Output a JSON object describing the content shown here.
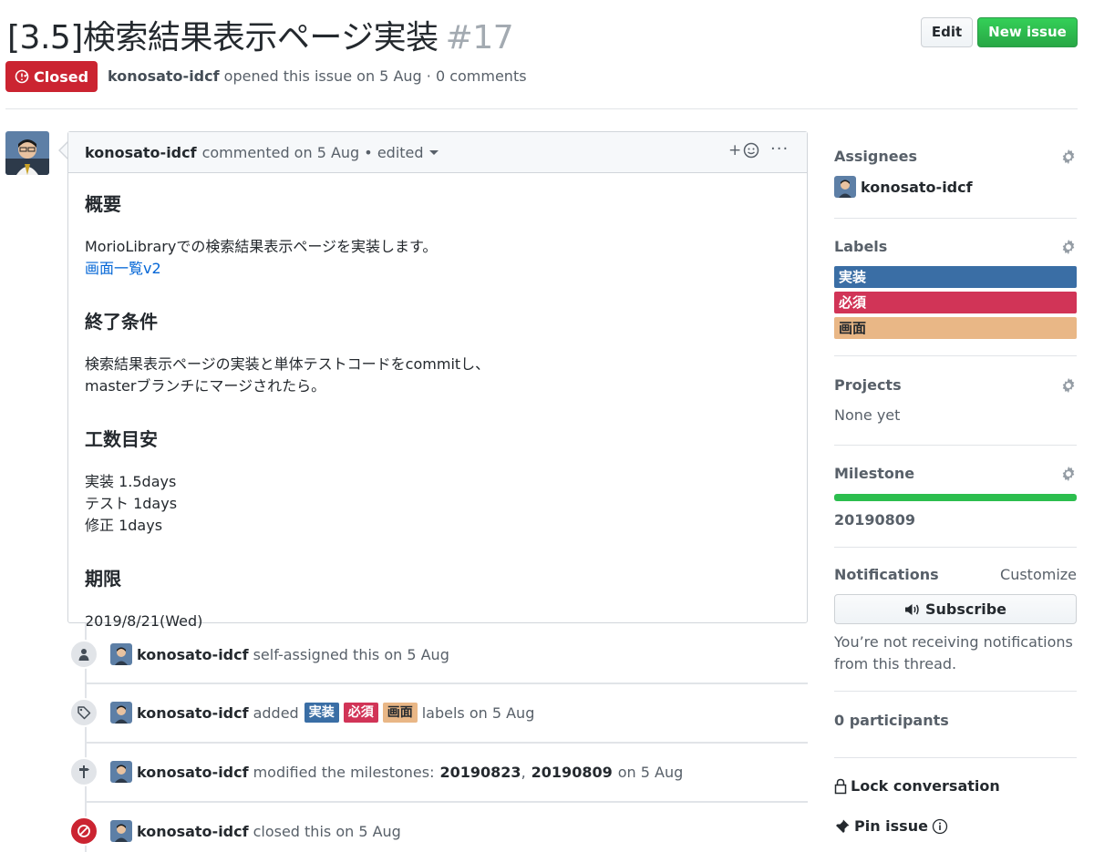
{
  "issue": {
    "title": "[3.5]検索結果表示ページ実装",
    "number": "#17",
    "state": "Closed",
    "author": "konosato-idcf",
    "meta_suffix": "opened this issue on 5 Aug · 0 comments"
  },
  "header_actions": {
    "edit": "Edit",
    "new_issue": "New issue"
  },
  "comment": {
    "author": "konosato-idcf",
    "meta": "commented on 5 Aug • edited",
    "reaction_label": "+",
    "more_label": "···",
    "sections": [
      {
        "heading": "概要",
        "lines": [
          "MorioLibraryでの検索結果表示ページを実装します。"
        ],
        "link": "画面一覧v2"
      },
      {
        "heading": "終了条件",
        "lines": [
          "検索結果表示ページの実装と単体テストコードをcommitし、",
          "masterブランチにマージされたら。"
        ]
      },
      {
        "heading": "工数目安",
        "lines": [
          "実装 1.5days",
          "テスト 1days",
          "修正 1days"
        ]
      },
      {
        "heading": "期限",
        "lines": [
          "2019/8/21(Wed)"
        ]
      }
    ]
  },
  "timeline": [
    {
      "icon": "person-icon",
      "user": "konosato-idcf",
      "text": "self-assigned this on 5 Aug"
    },
    {
      "icon": "tag-icon",
      "user": "konosato-idcf",
      "pre": "added",
      "labels": [
        "実装",
        "必須",
        "画面"
      ],
      "post": "labels on 5 Aug"
    },
    {
      "icon": "milestone-icon",
      "user": "konosato-idcf",
      "pre": "modified the milestones:",
      "m1": "20190823",
      "comma": ",",
      "m2": "20190809",
      "post": "on 5 Aug"
    },
    {
      "icon": "circle-slash-icon",
      "user": "konosato-idcf",
      "text": "closed this on 5 Aug"
    }
  ],
  "sidebar": {
    "assignees": {
      "title": "Assignees",
      "user": "konosato-idcf"
    },
    "labels": {
      "title": "Labels",
      "items": [
        {
          "name": "実装",
          "color": "#3a6ea5",
          "text_color": "#ffffff"
        },
        {
          "name": "必須",
          "color": "#d13457",
          "text_color": "#ffffff"
        },
        {
          "name": "画面",
          "color": "#e9b786",
          "text_color": "#24292e"
        }
      ]
    },
    "projects": {
      "title": "Projects",
      "value": "None yet"
    },
    "milestone": {
      "title": "Milestone",
      "value": "20190809",
      "progress": 1.0
    },
    "notifications": {
      "title": "Notifications",
      "customize": "Customize",
      "subscribe": "Subscribe",
      "desc_line1": "You’re not receiving notifications",
      "desc_line2": "from this thread."
    },
    "participants": "0 participants",
    "lock": "Lock conversation",
    "pin": "Pin issue"
  },
  "colors": {
    "closed": "#cb2431",
    "green": "#28a745",
    "link": "#0366d6"
  }
}
